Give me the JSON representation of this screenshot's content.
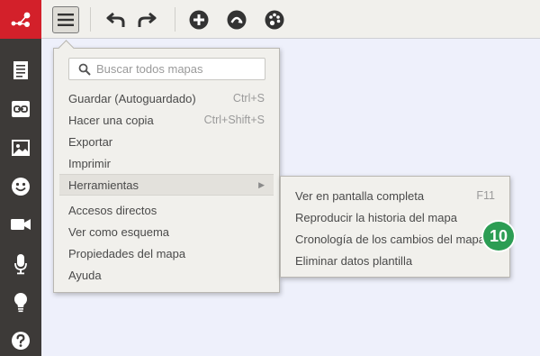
{
  "colors": {
    "rail": "#3d3a38",
    "logo_bg": "#d3202a",
    "toolbar_bg": "#f1f0ec",
    "canvas_bg": "#eef0fb",
    "badge": "#2c9d54"
  },
  "rail": {
    "logo_icon": "mindmap-logo-icon",
    "items": [
      {
        "icon": "document-icon"
      },
      {
        "icon": "link-icon"
      },
      {
        "icon": "image-icon"
      },
      {
        "icon": "smiley-icon"
      },
      {
        "icon": "video-camera-icon"
      },
      {
        "icon": "microphone-icon"
      },
      {
        "icon": "lightbulb-icon"
      },
      {
        "icon": "help-icon"
      }
    ]
  },
  "toolbar": {
    "items": [
      {
        "icon": "hamburger-menu-icon"
      },
      {
        "icon": "undo-icon"
      },
      {
        "icon": "redo-icon"
      },
      {
        "icon": "add-icon"
      },
      {
        "icon": "connect-icon"
      },
      {
        "icon": "palette-icon"
      }
    ]
  },
  "menu": {
    "search": {
      "placeholder": "Buscar todos mapas"
    },
    "items": [
      {
        "label": "Guardar (Autoguardado)",
        "shortcut": "Ctrl+S"
      },
      {
        "label": "Hacer una copia",
        "shortcut": "Ctrl+Shift+S"
      },
      {
        "label": "Exportar",
        "shortcut": ""
      },
      {
        "label": "Imprimir",
        "shortcut": ""
      },
      {
        "label": "Herramientas",
        "shortcut": "",
        "has_submenu": true,
        "highlighted": true
      },
      {
        "label": "Accesos directos",
        "shortcut": ""
      },
      {
        "label": "Ver como esquema",
        "shortcut": ""
      },
      {
        "label": "Propiedades del mapa",
        "shortcut": ""
      },
      {
        "label": "Ayuda",
        "shortcut": ""
      }
    ]
  },
  "submenu": {
    "items": [
      {
        "label": "Ver en pantalla completa",
        "shortcut": "F11"
      },
      {
        "label": "Reproducir la historia del mapa",
        "shortcut": ""
      },
      {
        "label": "Cronología de los cambios del mapa",
        "shortcut": ""
      },
      {
        "label": "Eliminar datos plantilla",
        "shortcut": ""
      }
    ]
  },
  "badge": {
    "text": "10"
  }
}
